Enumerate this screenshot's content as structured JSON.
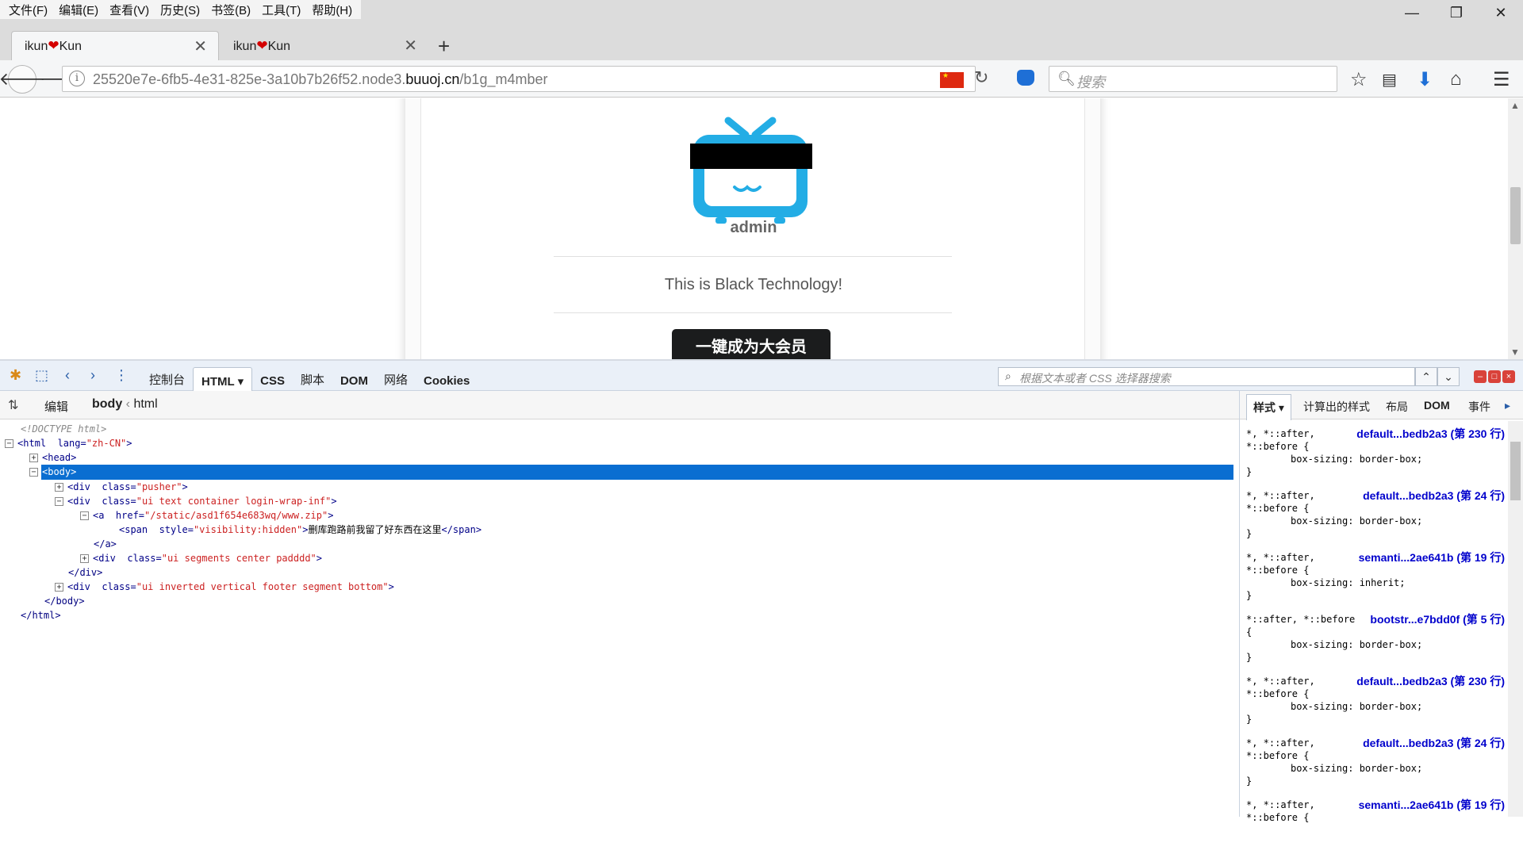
{
  "menu": [
    "文件(F)",
    "编辑(E)",
    "查看(V)",
    "历史(S)",
    "书签(B)",
    "工具(T)",
    "帮助(H)"
  ],
  "window": {
    "minimize": "—",
    "restore": "❐",
    "close": "✕"
  },
  "tabs": [
    {
      "prefix": "ikun",
      "heart": "❤",
      "suffix": "Kun",
      "close": "✕"
    },
    {
      "prefix": "ikun",
      "heart": "❤",
      "suffix": "Kun",
      "close": "✕"
    }
  ],
  "newtab": "+",
  "nav": {
    "url_prefix": "25520e7e-6fb5-4e31-825e-3a10b7b26f52.node3.",
    "url_host": "buuoj.cn",
    "url_path": "/b1g_m4mber",
    "search_placeholder": "搜索",
    "info_icon": "i"
  },
  "page": {
    "username": "admin",
    "tagline": "This is Black Technology!",
    "vip_button": "一键成为大会员"
  },
  "firebug": {
    "tabs": [
      "控制台",
      "HTML ▾",
      "CSS",
      "脚本",
      "DOM",
      "网络",
      "Cookies"
    ],
    "search_placeholder": "根据文本或者 CSS 选择器搜索",
    "edit": "编辑",
    "crumb_body": "body",
    "crumb_sep": "‹",
    "crumb_html": "html"
  },
  "html_tree": {
    "doctype": "<!DOCTYPE html>",
    "html_open": "<html",
    "html_attr": "lang=",
    "html_val": "\"zh-CN\"",
    "head": "<head>",
    "body": "<body>",
    "div_open": "<div",
    "class_attr": "class=",
    "pusher_val": "\"pusher\"",
    "login_val": "\"ui text container login-wrap-inf\"",
    "a_open": "<a",
    "href_attr": "href=",
    "href_val": "\"/static/asd1f654e683wq/www.zip\"",
    "span_open": "<span",
    "style_attr": "style=",
    "style_val": "\"visibility:hidden\"",
    "span_text": "删库跑路前我留了好东西在这里",
    "span_close": "</span>",
    "a_close": "</a>",
    "segments_val": "\"ui segments center padddd\"",
    "div_close": "</div>",
    "footer_val": "\"ui inverted vertical footer segment bottom\"",
    "body_close": "</body>",
    "html_close": "</html>",
    "gt": ">",
    "expand": "+",
    "collapse": "−"
  },
  "styles_panel": {
    "tabs": [
      "样式 ▾",
      "计算出的样式",
      "布局",
      "DOM",
      "事件"
    ],
    "rules": [
      {
        "sel1": "*, *::after,",
        "sel2": "*::before {",
        "src": "default...bedb2a3 (第 230 行)",
        "prop": "box-sizing: border-box;",
        "close": "}"
      },
      {
        "sel1": "*, *::after,",
        "sel2": "*::before {",
        "src": "default...bedb2a3 (第 24 行)",
        "prop": "box-sizing: border-box;",
        "close": "}"
      },
      {
        "sel1": "*, *::after,",
        "sel2": "*::before {",
        "src": "semanti...2ae641b (第 19 行)",
        "prop": "box-sizing: inherit;",
        "close": "}"
      },
      {
        "sel1": "*::after, *::before",
        "sel2": "{",
        "src": "bootstr...e7bdd0f (第 5 行)",
        "prop": "box-sizing: border-box;",
        "close": "}"
      },
      {
        "sel1": "*, *::after,",
        "sel2": "*::before {",
        "src": "default...bedb2a3 (第 230 行)",
        "prop": "box-sizing: border-box;",
        "close": "}"
      },
      {
        "sel1": "*, *::after,",
        "sel2": "*::before {",
        "src": "default...bedb2a3 (第 24 行)",
        "prop": "box-sizing: border-box;",
        "close": "}"
      },
      {
        "sel1": "*, *::after,",
        "sel2": "*::before {",
        "src": "semanti...2ae641b (第 19 行)",
        "prop": "",
        "close": ""
      }
    ]
  },
  "colors": {
    "accent": "#0a6ed1",
    "tv_icon": "#23ade5",
    "vip_button": "#1b1c1d"
  }
}
